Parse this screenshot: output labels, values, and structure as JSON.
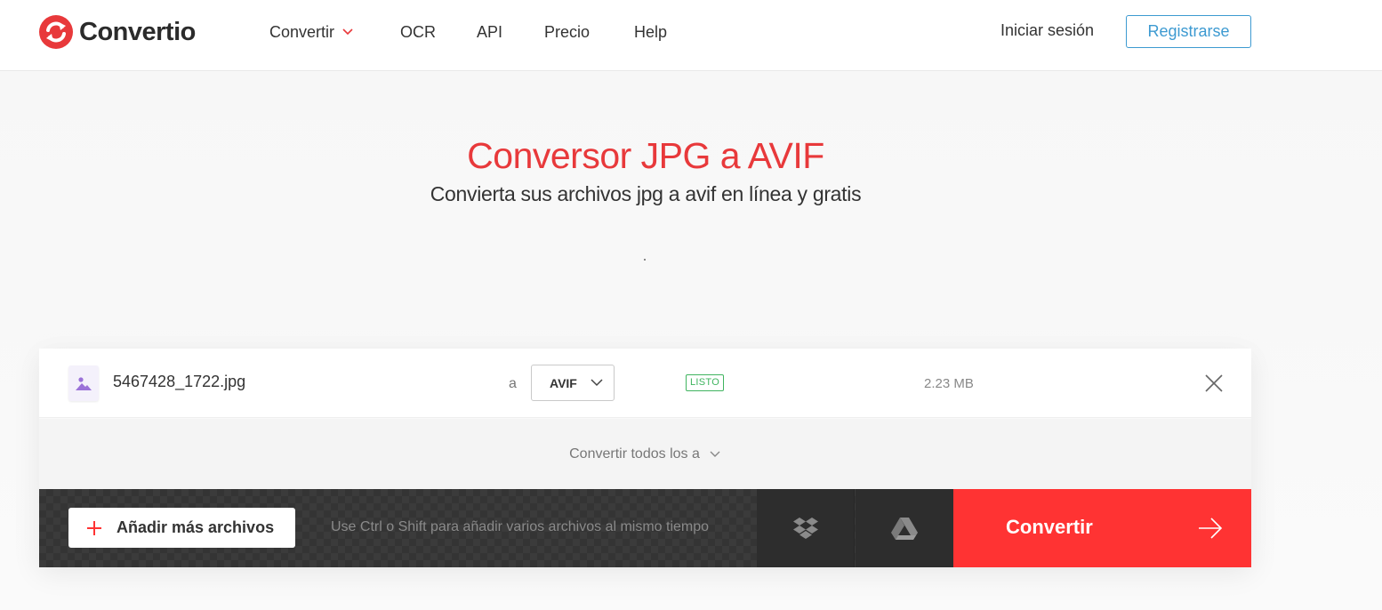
{
  "header": {
    "brand": "Convertio",
    "nav": {
      "convert": "Convertir",
      "ocr": "OCR",
      "api": "API",
      "pricing": "Precio",
      "help": "Help"
    },
    "login": "Iniciar sesión",
    "register": "Registrarse"
  },
  "hero": {
    "title": "Conversor JPG a AVIF",
    "subtitle": "Convierta sus archivos jpg a avif en línea y gratis"
  },
  "file": {
    "name": "5467428_1722.jpg",
    "to_label": "a",
    "format": "AVIF",
    "status": "LISTO",
    "size": "2.23 MB"
  },
  "convert_all": "Convertir todos los a",
  "actions": {
    "add_files": "Añadir más archivos",
    "hint": "Use Ctrl o Shift para añadir varios archivos al mismo tiempo",
    "convert": "Convertir"
  },
  "colors": {
    "brand_red": "#e8393b",
    "convert_red": "#ff3333",
    "link_blue": "#3d9ad1",
    "status_green": "#3fb45f"
  },
  "icons": [
    "convertio-logo-icon",
    "chevron-down-icon",
    "image-file-icon",
    "close-icon",
    "plus-icon",
    "dropbox-icon",
    "google-drive-icon",
    "arrow-right-icon"
  ]
}
